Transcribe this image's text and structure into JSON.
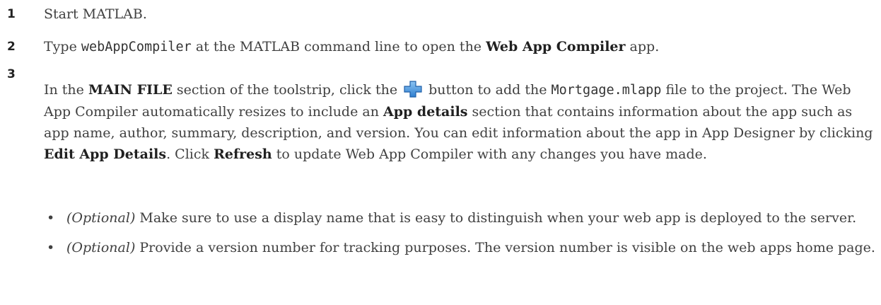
{
  "steps": [
    {
      "number": "1",
      "text": "Start MATLAB."
    },
    {
      "number": "2",
      "pre": "Type ",
      "code": "webAppCompiler",
      "mid": " at the MATLAB command line to open the ",
      "bold": "Web App Compiler",
      "post": " app."
    },
    {
      "number": "3",
      "t1": "In the ",
      "b1": "MAIN FILE",
      "t2": " section of the toolstrip, click the ",
      "icon": "add-plus-icon",
      "t3": " button to add the ",
      "code": "Mortgage.mlapp",
      "t4": " file to the project. The Web App Compiler automatically resizes to include an ",
      "b2": "App details",
      "t5": " section that contains information about the app such as app name, author, summary, description, and version. You can edit information about the app in App Designer by clicking ",
      "b3": "Edit App Details",
      "t6": ". Click ",
      "b4": "Refresh",
      "t7": " to update Web App Compiler with any changes you have made."
    }
  ],
  "bullets": [
    {
      "symbol": "•",
      "label": "(Optional)",
      "text": " Make sure to use a display name that is easy to distinguish when your web app is deployed to the server."
    },
    {
      "symbol": "•",
      "label": "(Optional)",
      "text": " Provide a version number for tracking purposes. The version number is visible on the web apps home page."
    }
  ],
  "colors": {
    "icon_fill": "#3f8fd8",
    "icon_edge": "#1f5fa8",
    "text": "#404040"
  }
}
